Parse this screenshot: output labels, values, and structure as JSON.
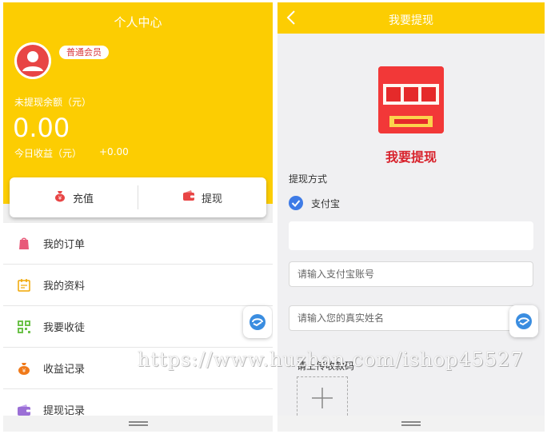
{
  "colors": {
    "primary": "#fccd02",
    "accent_red": "#d8222c",
    "check_blue": "#3e7be6"
  },
  "left": {
    "title": "个人中心",
    "member_badge": "普通会员",
    "balance_label": "未提现余额（元）",
    "balance_value": "0.00",
    "today_label": "今日收益（元）",
    "today_value": "+0.00",
    "actions": {
      "recharge": "充值",
      "withdraw": "提现"
    },
    "menu": [
      {
        "label": "我的订单",
        "icon": "orders-icon"
      },
      {
        "label": "我的资料",
        "icon": "profile-icon"
      },
      {
        "label": "我要收徒",
        "icon": "qrcode-icon"
      },
      {
        "label": "收益记录",
        "icon": "money-bag-icon"
      },
      {
        "label": "提现记录",
        "icon": "wallet-icon"
      }
    ]
  },
  "right": {
    "title": "我要提现",
    "heading": "我要提现",
    "method_label": "提现方式",
    "method_option": "支付宝",
    "account_placeholder": "请输入支付宝账号",
    "name_placeholder": "请输入您的真实姓名",
    "upload_label": "请上传收款码"
  },
  "watermark": "https://www.huzhan.com/ishop45527"
}
